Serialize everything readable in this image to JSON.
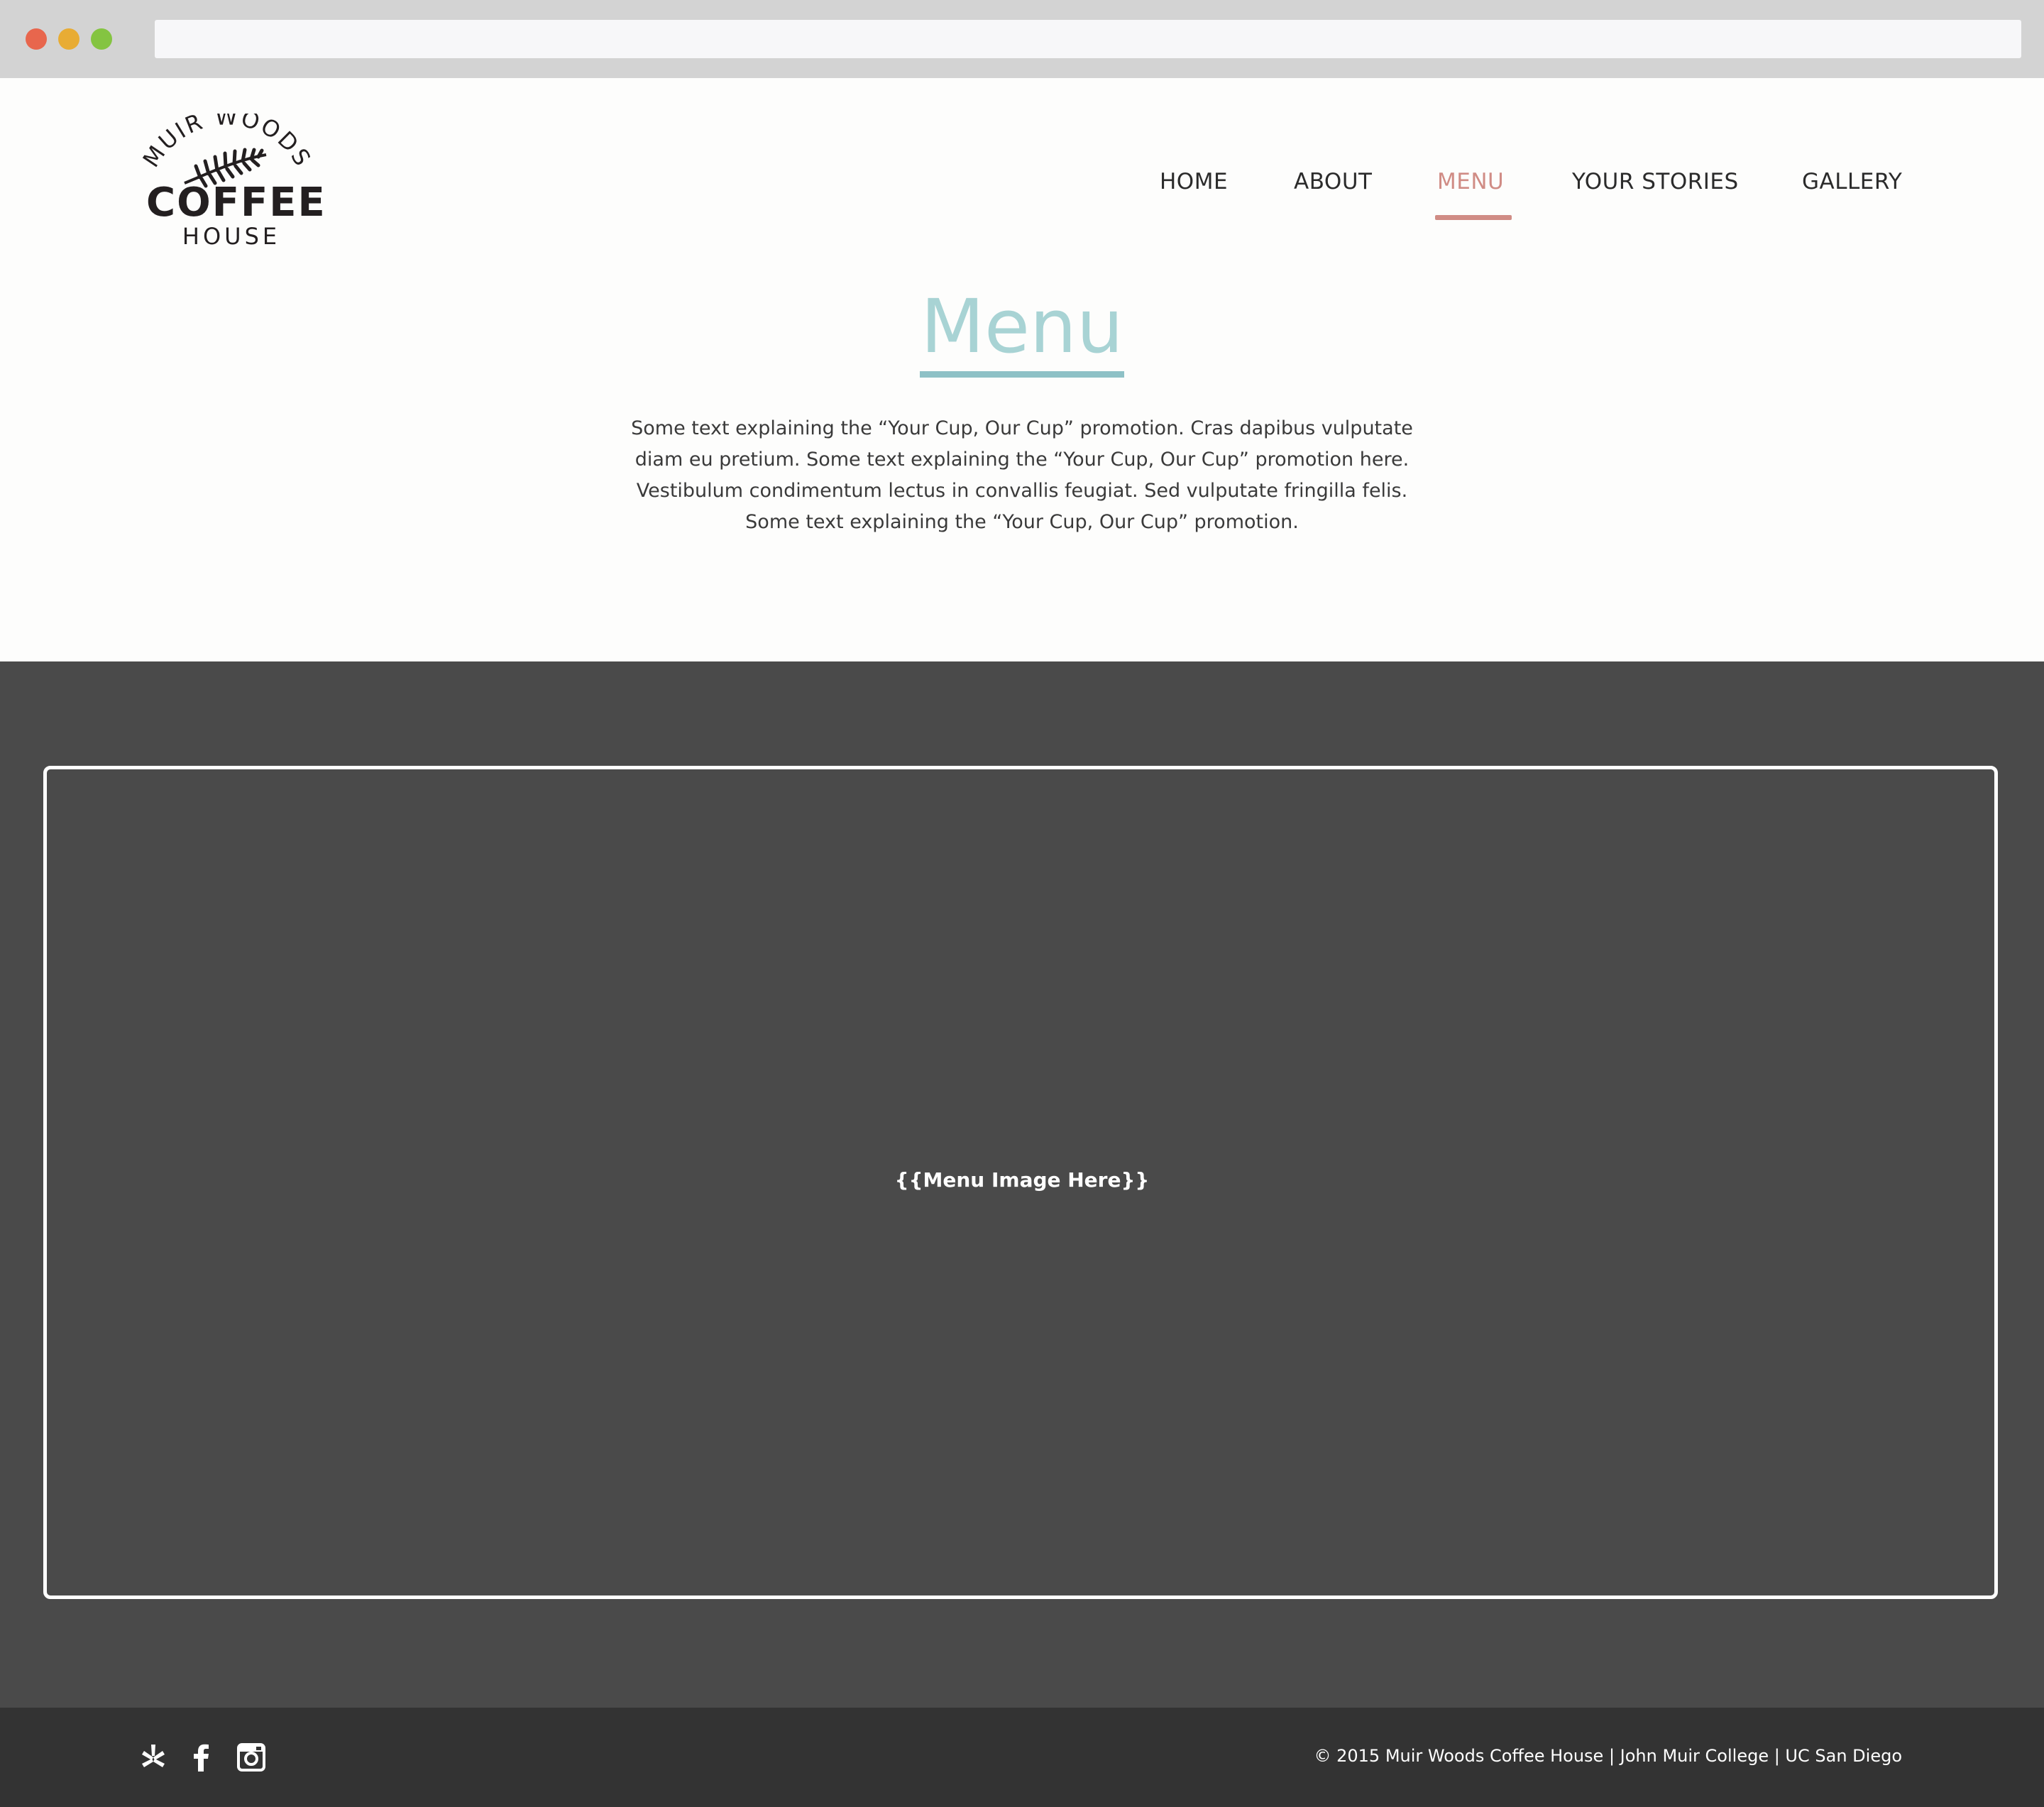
{
  "logo": {
    "arc_text": "MUIR WOODS",
    "main": "COFFEE",
    "sub": "HOUSE"
  },
  "nav": {
    "items": [
      {
        "label": "HOME",
        "active": false
      },
      {
        "label": "ABOUT",
        "active": false
      },
      {
        "label": "MENU",
        "active": true
      },
      {
        "label": "YOUR STORIES",
        "active": false
      },
      {
        "label": "GALLERY",
        "active": false
      }
    ]
  },
  "page": {
    "title": "Menu",
    "intro": "Some text explaining the “Your Cup, Our Cup” promotion. Cras dapibus vulputate diam eu pretium. Some text explaining the “Your Cup, Our Cup” promotion here. Vestibulum condimentum lectus in convallis feugiat. Sed vulputate fringilla felis. Some text explaining the “Your Cup, Our Cup” promotion."
  },
  "menu_section": {
    "placeholder": "{{Menu Image Here}}"
  },
  "footer": {
    "social_icons": [
      "yelp-icon",
      "facebook-icon",
      "instagram-icon"
    ],
    "copyright": "© 2015 Muir Woods Coffee House | John Muir College | UC San Diego"
  },
  "colors": {
    "accent_nav": "#d08c85",
    "title": "#a8d3d4",
    "title_underline": "#8ec1c6",
    "dark_section": "#4a4a4a",
    "footer": "#333333"
  }
}
